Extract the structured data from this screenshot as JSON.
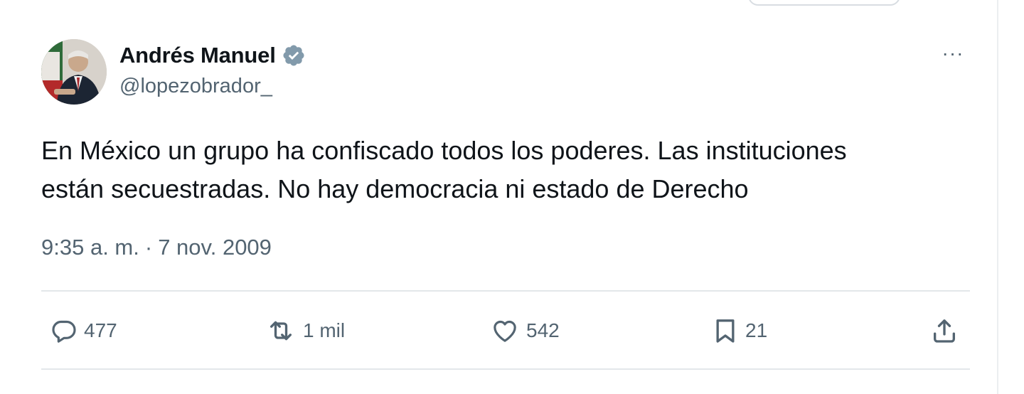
{
  "user": {
    "display_name": "Andrés Manuel",
    "handle": "@lopezobrador_",
    "verified": true,
    "avatar": "profile-photo"
  },
  "tweet": {
    "text_line1": "En México un grupo ha confiscado todos los poderes. Las instituciones",
    "text_line2": "están secuestradas. No hay democracia ni estado de Derecho",
    "time": "9:35 a. m.",
    "separator": "·",
    "date": "7 nov. 2009"
  },
  "actions": {
    "replies": "477",
    "retweets": "1 mil",
    "likes": "542",
    "bookmarks": "21"
  },
  "menu": {
    "more_label": "···"
  },
  "icons": {
    "reply": "reply-icon",
    "retweet": "retweet-icon",
    "like": "heart-icon",
    "bookmark": "bookmark-icon",
    "share": "share-icon",
    "verified": "verified-badge-icon",
    "more": "more-icon"
  },
  "colors": {
    "text_primary": "#0f1419",
    "text_secondary": "#536471",
    "verified_badge": "#829aab",
    "divider": "#e3e7ea"
  }
}
